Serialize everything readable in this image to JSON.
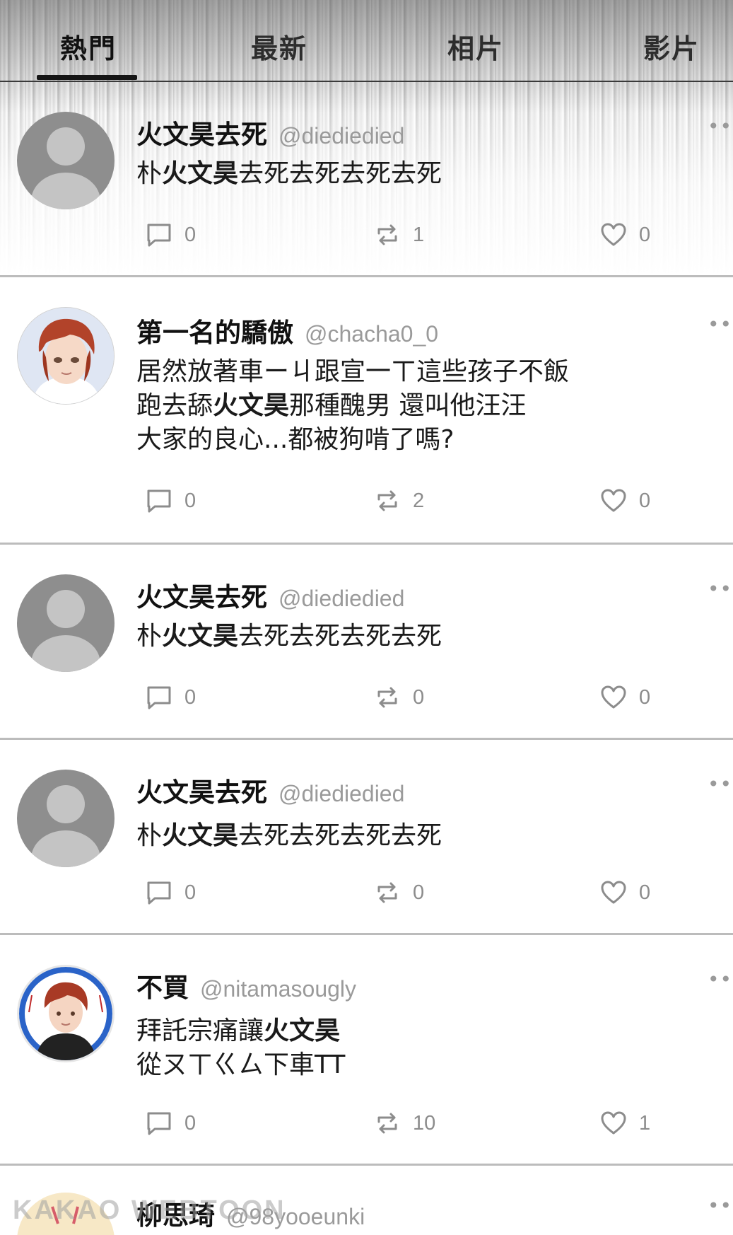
{
  "tabs": [
    "熱門",
    "最新",
    "相片",
    "影片"
  ],
  "active_tab": "熱門",
  "colors": {
    "divider": "#bcbcbc",
    "handle": "#9a9a9a",
    "icon": "#8c8c8c",
    "default_avatar": "#8e8e8e"
  },
  "posts": [
    {
      "name": "火文昊去死",
      "handle": "@diediedied",
      "text_parts": [
        [
          "朴",
          false
        ],
        [
          "火文昊",
          true
        ],
        [
          "去死去死去死去死",
          false
        ]
      ],
      "replies": "0",
      "reposts": "1",
      "likes": "0",
      "avatar": "default-avatar"
    },
    {
      "name": "第一名的驕傲",
      "handle": "@chacha0_0",
      "text_parts": [
        [
          "居然放著車ーㄐ跟宣一ㄒ這些孩子不飯\n跑去舔",
          false
        ],
        [
          "火文昊",
          true
        ],
        [
          "那種醜男 還叫他汪汪\n大家的良心...都被狗啃了嗎?",
          false
        ]
      ],
      "replies": "0",
      "reposts": "2",
      "likes": "0",
      "avatar": "illustrated-avatar-red-hair"
    },
    {
      "name": "火文昊去死",
      "handle": "@diediedied",
      "text_parts": [
        [
          "朴",
          false
        ],
        [
          "火文昊",
          true
        ],
        [
          "去死去死去死去死",
          false
        ]
      ],
      "replies": "0",
      "reposts": "0",
      "likes": "0",
      "avatar": "default-avatar"
    },
    {
      "name": "火文昊去死",
      "handle": "@diediedied",
      "text_parts": [
        [
          "朴",
          false
        ],
        [
          "火文昊",
          true
        ],
        [
          "去死去死去死去死",
          false
        ]
      ],
      "replies": "0",
      "reposts": "0",
      "likes": "0",
      "avatar": "default-avatar"
    },
    {
      "name": "不買",
      "handle": "@nitamasougly",
      "text_parts": [
        [
          "拜託宗痛讓",
          false
        ],
        [
          "火文昊",
          true
        ],
        [
          "\n從ㄡㄒㄍㄙ下車TT",
          false
        ]
      ],
      "replies": "0",
      "reposts": "10",
      "likes": "1",
      "avatar": "illustrated-avatar-blue-circle"
    },
    {
      "name": "柳思琦",
      "handle": "@98yooeunki",
      "text_parts": [],
      "replies": "",
      "reposts": "",
      "likes": "",
      "avatar": "illustrated-avatar-peach"
    }
  ],
  "watermark": "KAKAO WEBTOON"
}
